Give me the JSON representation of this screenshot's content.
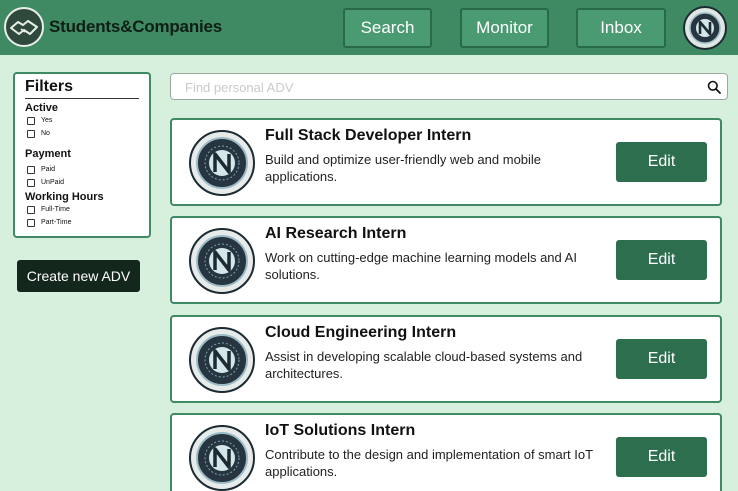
{
  "header": {
    "app_title": "Students&Companies",
    "nav": [
      {
        "label": "Search"
      },
      {
        "label": "Monitor"
      },
      {
        "label": "Inbox"
      }
    ],
    "colors": {
      "header_bg": "#3f8a63",
      "page_bg": "#d6f0dd",
      "accent": "#2d6e4f"
    }
  },
  "filters": {
    "title": "Filters",
    "groups": [
      {
        "title": "Active",
        "options": [
          "Yes",
          "No"
        ]
      },
      {
        "title": "Payment",
        "options": [
          "Paid",
          "UnPaid"
        ]
      },
      {
        "title": "Working Hours",
        "options": [
          "Full-Time",
          "Part-Time"
        ]
      }
    ]
  },
  "create_button": "Create new ADV",
  "search": {
    "placeholder": "Find personal ADV",
    "value": ""
  },
  "cards": [
    {
      "title": "Full Stack Developer Intern",
      "desc": "Build and optimize user-friendly web and mobile applications.",
      "action": "Edit"
    },
    {
      "title": "AI Research Intern",
      "desc": "Work on cutting-edge machine learning models and AI solutions.",
      "action": "Edit"
    },
    {
      "title": "Cloud Engineering Intern",
      "desc": "Assist in developing scalable cloud-based systems and architectures.",
      "action": "Edit"
    },
    {
      "title": "IoT Solutions Intern",
      "desc": "Contribute to the design and implementation of smart IoT applications.",
      "action": "Edit"
    }
  ]
}
